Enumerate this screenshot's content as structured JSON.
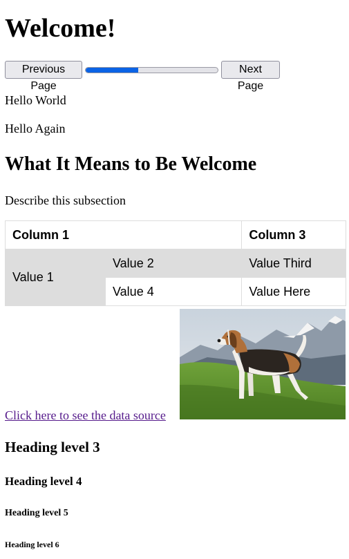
{
  "page": {
    "title": "Welcome!"
  },
  "nav": {
    "prev_label": "Previous Page",
    "next_label": "Next Page",
    "progress_fraction": 0.4
  },
  "paragraphs": {
    "p1": "Hello World",
    "p2": "Hello Again"
  },
  "section": {
    "heading": "What It Means to Be Welcome",
    "description": "Describe this subsection"
  },
  "table": {
    "headers": [
      "Column 1",
      "Column 3"
    ],
    "rows": [
      [
        "Value 1",
        "Value 2",
        "Value Third"
      ],
      [
        "Value 4",
        "Value Here"
      ]
    ]
  },
  "link": {
    "text": "Click here to see the data source"
  },
  "image": {
    "subject": "beagle-dog-photo"
  },
  "headings": {
    "h3": "Heading level 3",
    "h4": "Heading level 4",
    "h5": "Heading level 5",
    "h6": "Heading level 6"
  },
  "colors": {
    "progress_fill": "#0b63e5",
    "link_visited": "#551a8b",
    "table_shade": "#dddddd"
  }
}
